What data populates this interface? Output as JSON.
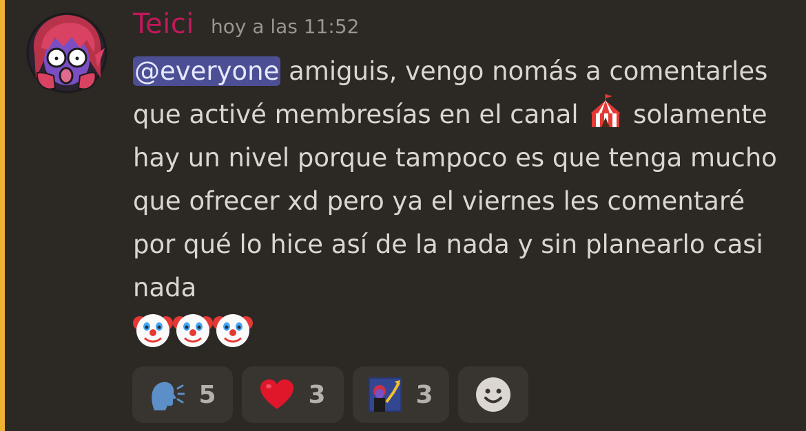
{
  "theme": {
    "background": "#2c2824",
    "highlight_bar": "#f0b232",
    "username_color": "#c2185b",
    "mention_bg": "#4c4f94",
    "reaction_bg": "#38342f"
  },
  "message": {
    "author": "Teici",
    "timestamp": "hoy a las 11:52",
    "mention": "@everyone",
    "text_part1": " amiguis, vengo nomás a comentarles que activé membresías en el canal ",
    "inline_emoji_1": "circus-tent",
    "text_part2": " solamente hay un nivel porque tampoco es que tenga mucho que ofrecer xd pero ya el viernes les comentaré por qué lo hice así de la nada y sin planearlo casi nada",
    "trailing_emojis": [
      "clown-face",
      "clown-face",
      "clown-face"
    ]
  },
  "reactions": [
    {
      "emoji": "speaking-head",
      "count": "5"
    },
    {
      "emoji": "red-heart",
      "count": "3"
    },
    {
      "emoji": "custom-avatar-chart",
      "count": "3"
    }
  ],
  "add_reaction_icon": "add-reaction-smile"
}
